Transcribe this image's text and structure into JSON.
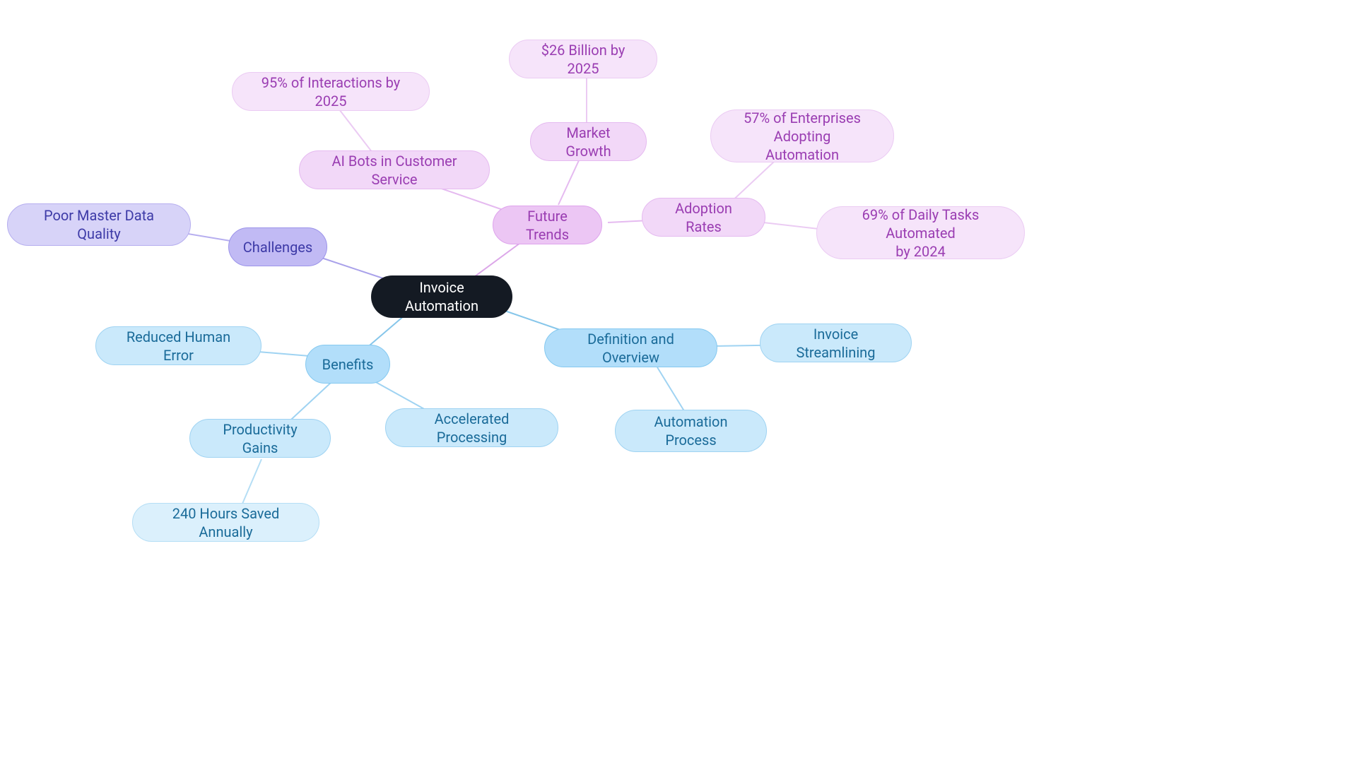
{
  "root": "Invoice Automation",
  "challenges": {
    "label": "Challenges",
    "items": [
      "Poor Master Data Quality"
    ]
  },
  "future": {
    "label": "Future Trends",
    "ai_bots": {
      "label": "AI Bots in Customer Service",
      "child": "95% of Interactions by 2025"
    },
    "market": {
      "label": "Market Growth",
      "child": "$26 Billion by 2025"
    },
    "adoption": {
      "label": "Adoption Rates",
      "c1": "57% of Enterprises Adopting\nAutomation",
      "c2": "69% of Daily Tasks Automated\nby 2024"
    }
  },
  "definition": {
    "label": "Definition and Overview",
    "items": [
      "Invoice Streamlining",
      "Automation Process"
    ]
  },
  "benefits": {
    "label": "Benefits",
    "reduced": "Reduced Human Error",
    "accel": "Accelerated Processing",
    "prod": {
      "label": "Productivity Gains",
      "child": "240 Hours Saved Annually"
    }
  },
  "colors": {
    "edge_indigo": "#a9a1ea",
    "edge_pink": "#dca7e9",
    "edge_blue": "#86c6ea"
  }
}
